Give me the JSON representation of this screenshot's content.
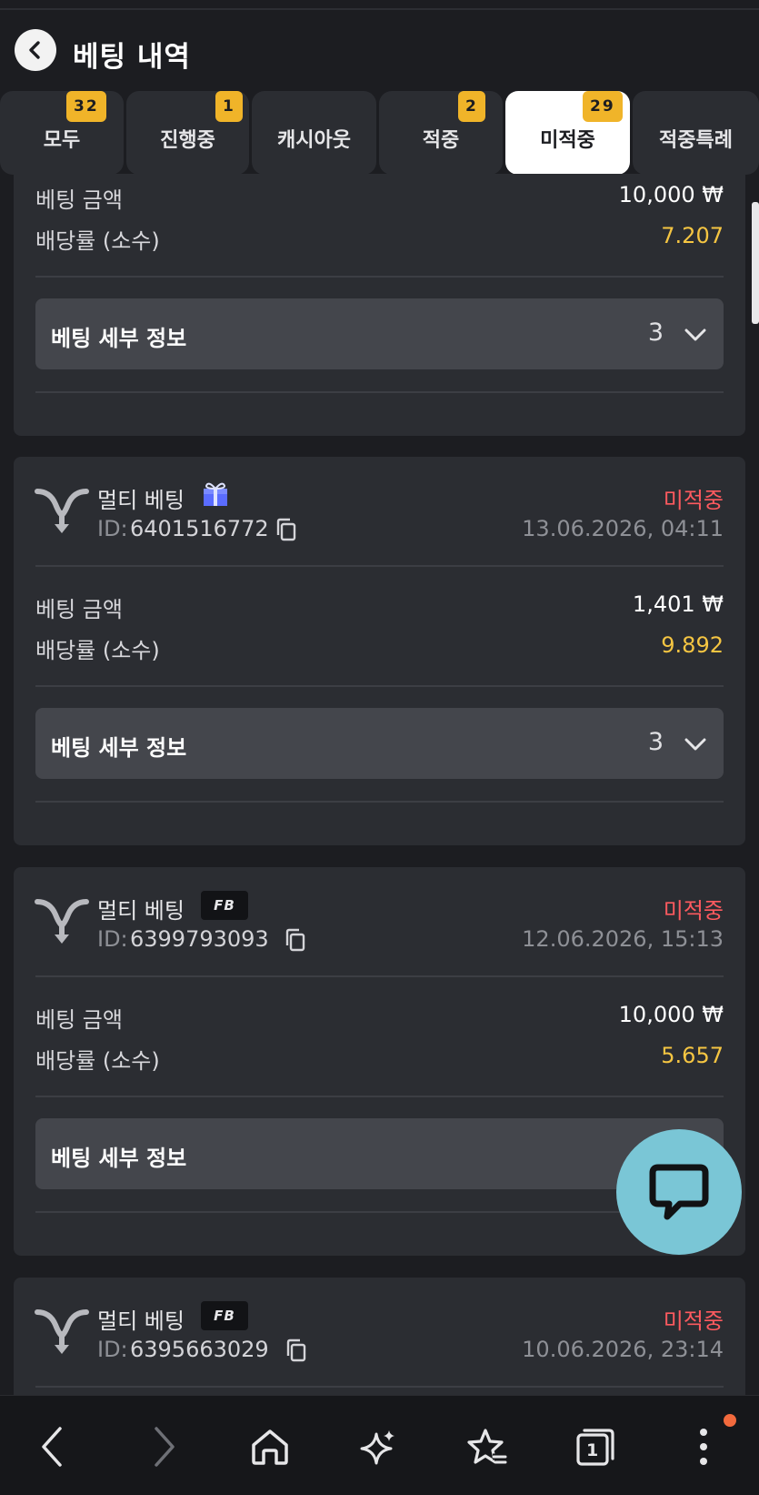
{
  "header": {
    "title": "베팅 내역"
  },
  "tabs": [
    {
      "label": "모두",
      "badge": "32"
    },
    {
      "label": "진행중",
      "badge": "1"
    },
    {
      "label": "캐시아웃",
      "badge": ""
    },
    {
      "label": "적중",
      "badge": "2"
    },
    {
      "label": "미적중",
      "badge": "29"
    },
    {
      "label": "적중특례",
      "badge": ""
    }
  ],
  "labels": {
    "amount": "베팅 금액",
    "odds": "배당률 (소수)",
    "details": "베팅 세부 정보",
    "id_prefix": "ID:"
  },
  "bets": [
    {
      "amount": "10,000 ₩",
      "odds": "7.207",
      "details_count": "3"
    },
    {
      "title": "멀티 베팅",
      "tag": "gift",
      "id": "6401516772",
      "status": "미적중",
      "date": "13.06.2026, 04:11",
      "amount": "1,401 ₩",
      "odds": "9.892",
      "details_count": "3"
    },
    {
      "title": "멀티 베팅",
      "tag": "FB",
      "id": "6399793093",
      "status": "미적중",
      "date": "12.06.2026, 15:13",
      "amount": "10,000 ₩",
      "odds": "5.657",
      "details_count": ""
    },
    {
      "title": "멀티 베팅",
      "tag": "FB",
      "id": "6395663029",
      "status": "미적중",
      "date": "10.06.2026, 23:14"
    }
  ],
  "colors": {
    "accent_badge": "#f0b429",
    "odds": "#f5c542",
    "lost": "#ff5a5f",
    "chat": "#7ac6d6",
    "background": "#1c1d21",
    "card": "#2b2d32"
  },
  "icons": [
    "back-arrow-icon",
    "multi-bet-icon",
    "gift-icon",
    "copy-icon",
    "chevron-down-icon",
    "chat-icon",
    "nav-back-icon",
    "nav-forward-icon",
    "home-icon",
    "sparkle-icon",
    "bookmark-star-icon",
    "tabs-icon",
    "more-icon"
  ],
  "bottom_nav": {
    "tabs_count": "1"
  }
}
